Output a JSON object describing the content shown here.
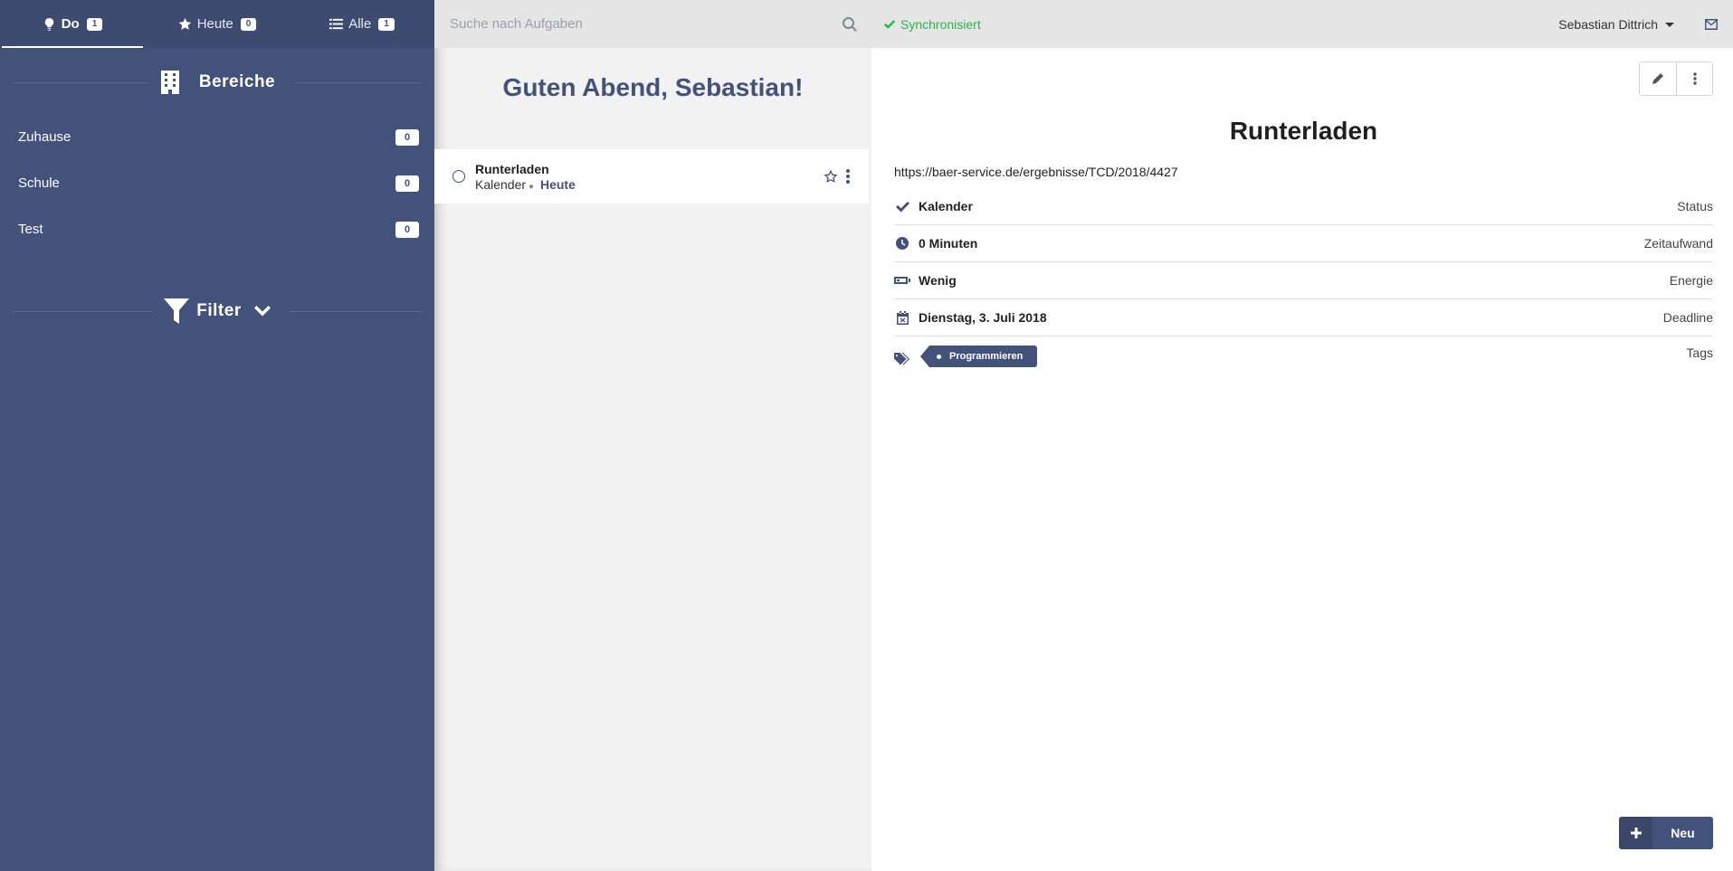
{
  "sidebar": {
    "tabs": [
      {
        "label": "Do",
        "count": "1",
        "icon": "lightbulb-icon"
      },
      {
        "label": "Heute",
        "count": "0",
        "icon": "star-icon"
      },
      {
        "label": "Alle",
        "count": "1",
        "icon": "list-icon"
      }
    ],
    "areas_title": "Bereiche",
    "areas": [
      {
        "label": "Zuhause",
        "count": "0"
      },
      {
        "label": "Schule",
        "count": "0"
      },
      {
        "label": "Test",
        "count": "0"
      }
    ],
    "filter_title": "Filter"
  },
  "search": {
    "placeholder": "Suche nach Aufgaben"
  },
  "greeting": "Guten Abend, Sebastian!",
  "tasks": [
    {
      "title": "Runterladen",
      "project": "Kalender",
      "due": "Heute"
    }
  ],
  "topbar": {
    "sync_status": "Synchronisiert",
    "user_name": "Sebastian Dittrich"
  },
  "detail": {
    "title": "Runterladen",
    "url": "https://baer-service.de/ergebnisse/TCD/2018/4427",
    "properties": {
      "status": {
        "value": "Kalender",
        "label": "Status"
      },
      "effort": {
        "value": "0 Minuten",
        "label": "Zeitaufwand"
      },
      "energy": {
        "value": "Wenig",
        "label": "Energie"
      },
      "deadline": {
        "value": "Dienstag, 3. Juli 2018",
        "label": "Deadline"
      },
      "tags": {
        "label": "Tags",
        "items": [
          "Programmieren"
        ]
      }
    }
  },
  "new_button": {
    "label": "Neu"
  },
  "colors": {
    "primary": "#43527a",
    "sync": "#21ba45",
    "sidebar_tabs": "#3d4b70"
  }
}
